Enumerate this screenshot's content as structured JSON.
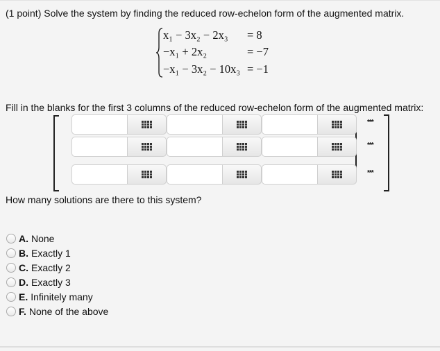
{
  "problem": {
    "prompt": "(1 point) Solve the system by finding the reduced row-echelon form of the augmented matrix.",
    "equations": [
      {
        "lhs": "x₁ − 3x₂ − 2x₃",
        "rhs": "= 8"
      },
      {
        "lhs": "−x₁ + 2x₂",
        "rhs": "= −7"
      },
      {
        "lhs": "−x₁ − 3x₂ − 10x₃",
        "rhs": "= −1"
      }
    ]
  },
  "matrix": {
    "label": "Fill in the blanks for the first 3 columns of the reduced row-echelon form of the augmented matrix:",
    "rows": [
      {
        "cells": [
          "",
          "",
          ""
        ],
        "augmented": "***"
      },
      {
        "cells": [
          "",
          "",
          ""
        ],
        "augmented": "***"
      },
      {
        "cells": [
          "",
          "",
          ""
        ],
        "augmented": "***"
      }
    ],
    "button_icon": "keypad-grid-icon"
  },
  "question": {
    "text": "How many solutions are there to this system?",
    "options": [
      {
        "letter": "A.",
        "label": "None"
      },
      {
        "letter": "B.",
        "label": "Exactly 1"
      },
      {
        "letter": "C.",
        "label": "Exactly 2"
      },
      {
        "letter": "D.",
        "label": "Exactly 3"
      },
      {
        "letter": "E.",
        "label": "Infinitely many"
      },
      {
        "letter": "F.",
        "label": "None of the above"
      }
    ],
    "selected": null
  }
}
